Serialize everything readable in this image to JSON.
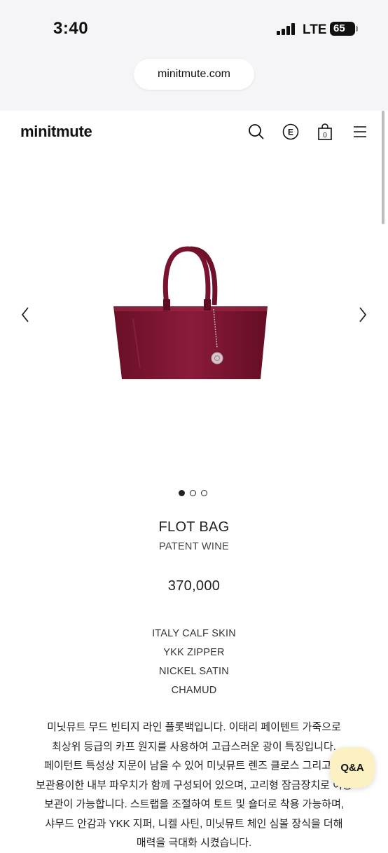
{
  "status_bar": {
    "time": "3:40",
    "network": "LTE",
    "battery": "65"
  },
  "browser": {
    "url": "minitmute.com"
  },
  "header": {
    "logo": "minitmute",
    "icons": [
      "search-icon",
      "e-points-icon",
      "cart-icon",
      "menu-icon"
    ],
    "cart_count": "0",
    "e_label": "E"
  },
  "gallery": {
    "slide_count": 3,
    "active_slide": 1,
    "bag_color": "#7a1330"
  },
  "product": {
    "name": "FLOT BAG",
    "color": "PATENT WINE",
    "price": "370,000",
    "specs": [
      "ITALY CALF SKIN",
      "YKK ZIPPER",
      "NICKEL SATIN",
      "CHAMUD"
    ],
    "description": "미닛뮤트 무드 빈티지 라인 플롯백입니다. 이태리 페이텐트 가죽으로 최상위 등급의 카프 원지를 사용하여 고급스러운 광이 특징입니다. 페이턴트 특성상 지문이 남을 수 있어 미닛뮤트 렌즈 클로스 그리고 짐 보관용이한 내부 파우치가 함께 구성되어 있으며, 고리형 잠금장치로 이동 보관이 가능합니다. 스트랩을 조절하여 토트 및 숄더로 착용 가능하며, 샤무드 안감과 YKK 지퍼, 니켈 사틴, 미닛뮤트 체인 심볼 장식을 더해 매력을 극대화 시켰습니다."
  },
  "qa_button": {
    "label": "Q&A"
  }
}
